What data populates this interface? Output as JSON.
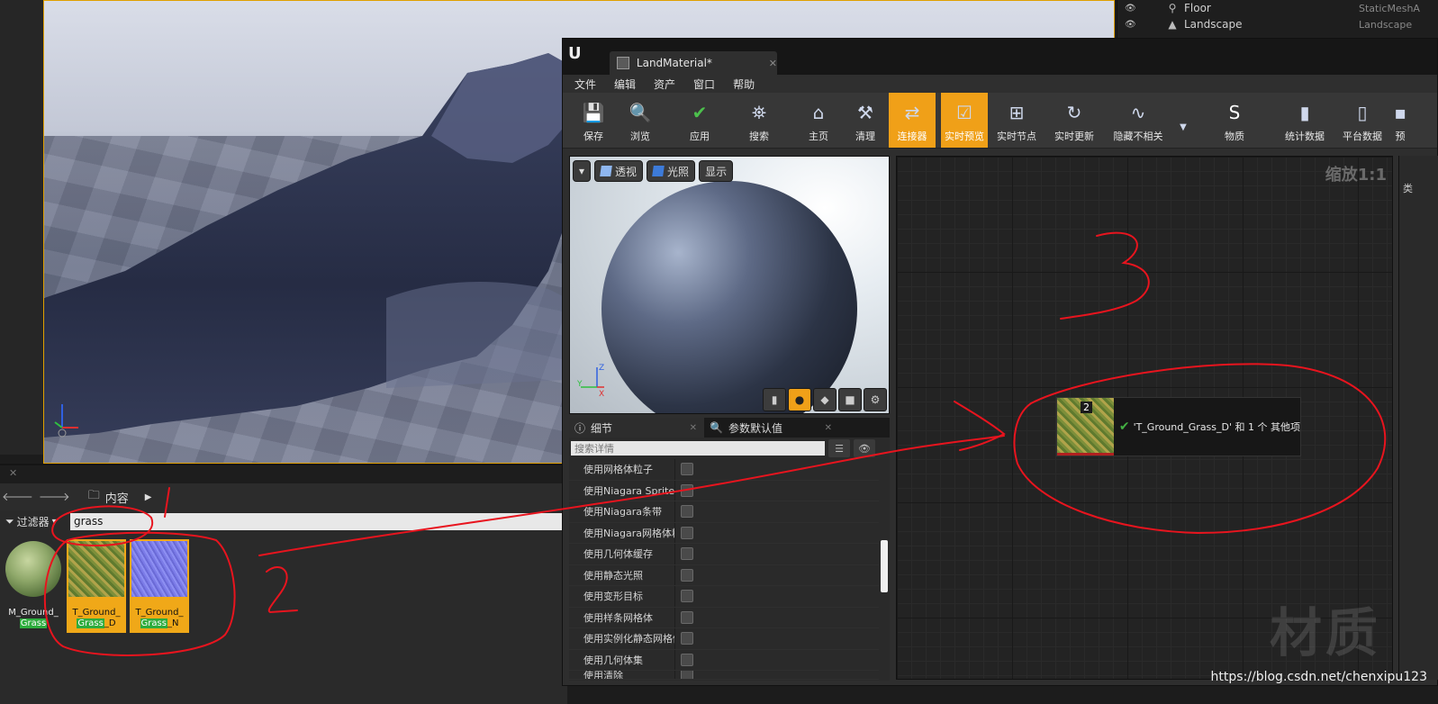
{
  "outliner": {
    "rows": [
      {
        "name": "Floor",
        "type": "StaticMeshA"
      },
      {
        "name": "Landscape",
        "type": "Landscape"
      }
    ]
  },
  "content_browser": {
    "breadcrumb": "内容",
    "filter_label": "过滤器",
    "search_value": "grass",
    "assets": [
      {
        "line1": "M_Ground_",
        "match": "Grass",
        "suffix": ""
      },
      {
        "line1": "T_Ground_",
        "match": "Grass",
        "suffix": "_D"
      },
      {
        "line1": "T_Ground_",
        "match": "Grass",
        "suffix": "_N"
      }
    ]
  },
  "material_editor": {
    "tab_title": "LandMaterial*",
    "menu": [
      "文件",
      "编辑",
      "资产",
      "窗口",
      "帮助"
    ],
    "toolbar": [
      {
        "label": "保存",
        "icon": "save-icon"
      },
      {
        "label": "浏览",
        "icon": "magnifier-icon"
      },
      {
        "label": "应用",
        "icon": "checkmark-icon"
      },
      {
        "label": "搜索",
        "icon": "binoculars-icon"
      },
      {
        "label": "主页",
        "icon": "home-icon"
      },
      {
        "label": "清理",
        "icon": "broom-icon"
      },
      {
        "label": "连接器",
        "icon": "connector-icon"
      },
      {
        "label": "实时预览",
        "icon": "tv-check-icon"
      },
      {
        "label": "实时节点",
        "icon": "live-nodes-icon"
      },
      {
        "label": "实时更新",
        "icon": "refresh-clock-icon"
      },
      {
        "label": "隐藏不相关",
        "icon": "hide-unrelated-icon"
      },
      {
        "label": "物质",
        "icon": "substance-icon"
      },
      {
        "label": "统计数据",
        "icon": "stats-icon"
      },
      {
        "label": "平台数据",
        "icon": "platform-icon"
      },
      {
        "label": "预",
        "icon": "preview-icon"
      }
    ],
    "preview": {
      "perspective_label": "透视",
      "lit_label": "光照",
      "show_label": "显示",
      "axis_z": "Z",
      "axis_x": "X",
      "axis_y": "Y"
    },
    "details": {
      "tab_details": "细节",
      "tab_params": "参数默认值",
      "search_placeholder": "搜索详情",
      "properties": [
        "使用网格体粒子",
        "使用Niagara Sprites",
        "使用Niagara条带",
        "使用Niagara网格体粒子",
        "使用几何体缓存",
        "使用静态光照",
        "使用变形目标",
        "使用样条网格体",
        "使用实例化静态网格体",
        "使用几何体集",
        "使用清除"
      ]
    },
    "graph": {
      "zoom_label": "缩放1:1",
      "watermark": "材质",
      "drag_count": "2",
      "drag_text": "'T_Ground_Grass_D' 和 1 个 其他项"
    },
    "right_strip_label": "类"
  },
  "url_watermark": "https://blog.csdn.net/chenxipu123",
  "colors": {
    "accent": "#f0a018",
    "annotation": "#e8141e",
    "highlight": "#2dac3d"
  }
}
